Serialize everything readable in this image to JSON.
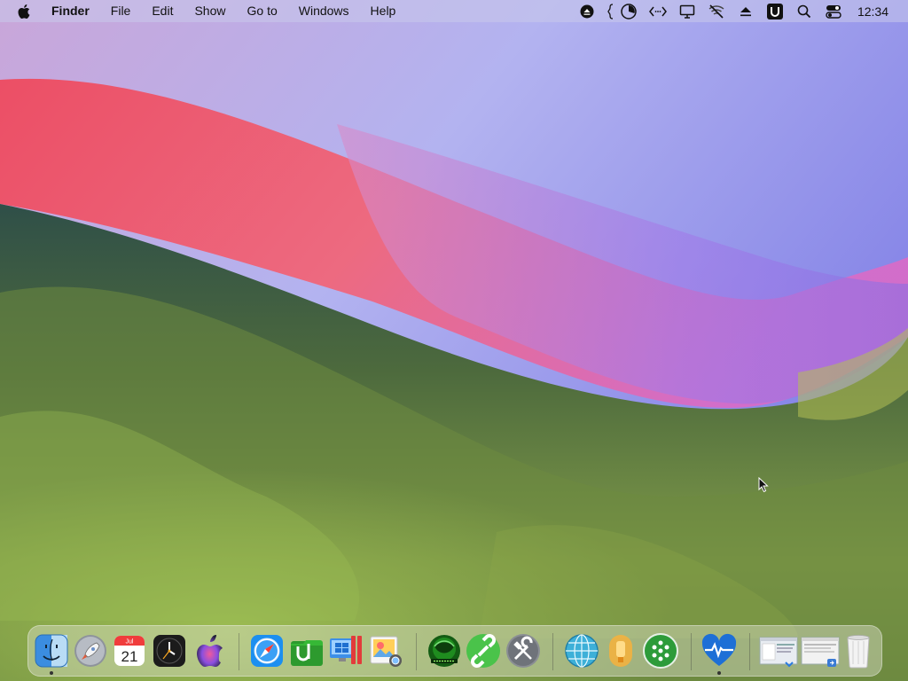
{
  "menubar": {
    "app_name": "Finder",
    "menus": [
      "File",
      "Edit",
      "Show",
      "Go to",
      "Windows",
      "Help"
    ],
    "status_icons": [
      "eject-icon",
      "status-bracket-icon",
      "pie-chart-icon",
      "code-arrows-icon",
      "display-icon",
      "wifi-off-icon",
      "upload-icon",
      "u-app-icon",
      "search-icon",
      "control-center-icon"
    ],
    "clock": "12:34"
  },
  "dock": {
    "calendar": {
      "month": "Jul",
      "day": "21"
    },
    "running_apps": [
      "Finder",
      "Health Monitor"
    ]
  },
  "colors": {
    "menubar_bg": "#c8c8eb",
    "wallpaper_red": "#e9495d",
    "wallpaper_violet": "#8f7ff0",
    "wallpaper_green": "#5a7a3c"
  }
}
